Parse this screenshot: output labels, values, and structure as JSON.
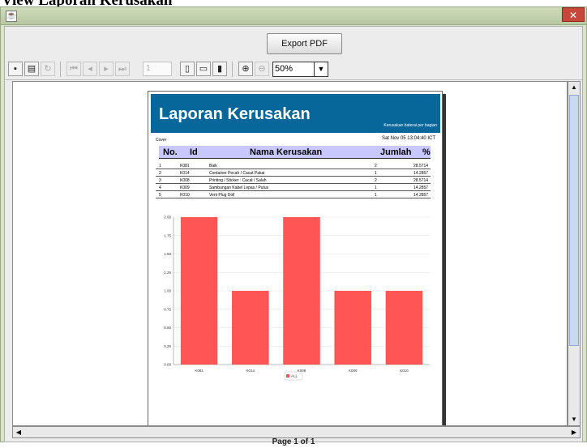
{
  "window": {
    "heading": "View Laporan Kerusakan",
    "close_glyph": "✕"
  },
  "toolbar": {
    "export_label": "Export PDF",
    "page_field": "1",
    "zoom_value": "50%",
    "icons": [
      "save-icon",
      "print-icon",
      "reload-icon",
      "first-page-icon",
      "prev-page-icon",
      "next-page-icon",
      "last-page-icon",
      "actual-size-icon",
      "fit-page-icon",
      "fit-width-icon",
      "zoom-in-icon",
      "zoom-out-icon"
    ]
  },
  "report": {
    "title": "Laporan Kerusakan",
    "subtitle": "Kerusakan baterai per bagian",
    "cover": "Cover",
    "date": "Sat Nov 05 13:04:40 ICT",
    "columns": [
      "No.",
      "Id",
      "Nama Kerusakan",
      "Jumlah",
      "%"
    ],
    "rows": [
      [
        "1",
        "K081",
        "Baik",
        "2",
        "28.5714"
      ],
      [
        "2",
        "K014",
        "Container Pecah / Cacat Pakai",
        "1",
        "14.2857"
      ],
      [
        "3",
        "K008",
        "Printing / Sticker : Cacat / Salah",
        "2",
        "28.5714"
      ],
      [
        "4",
        "K009",
        "Sambungan Kabel Lepas / Putus",
        "1",
        "14.2857"
      ],
      [
        "5",
        "K010",
        "Vent Plug Doll",
        "1",
        "14.2857"
      ]
    ]
  },
  "chart_data": {
    "type": "bar",
    "categories": [
      "K081",
      "K014",
      "K008",
      "K009",
      "K010"
    ],
    "series": [
      {
        "name": "ALL",
        "values": [
          2,
          1,
          2,
          1,
          1
        ]
      }
    ],
    "yticks": [
      "0.00",
      "0.25",
      "0.50",
      "0.75",
      "1.00",
      "1.25",
      "1.50",
      "1.75",
      "2.00"
    ],
    "ylim": [
      0,
      2
    ],
    "bar_color": "#ff5555",
    "legend_position": "bottom"
  },
  "status": {
    "page_label": "Page 1 of 1"
  }
}
